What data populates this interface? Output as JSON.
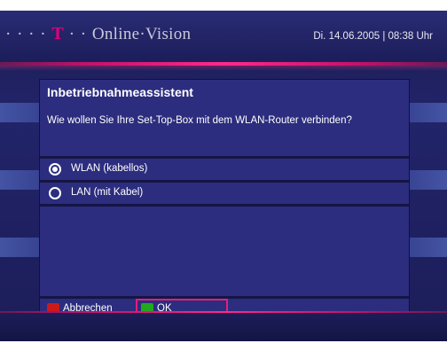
{
  "header": {
    "brand_dots": "· · · · ",
    "brand_t": "T",
    "brand_dots2": " · · ",
    "brand_name": "Online·Vision",
    "datetime": "Di. 14.06.2005 | 08:38 Uhr"
  },
  "dialog": {
    "title": "Inbetriebnahmeassistent",
    "question": "Wie wollen Sie Ihre Set-Top-Box mit dem WLAN-Router verbinden?",
    "options": [
      {
        "label": "WLAN (kabellos)",
        "selected": true
      },
      {
        "label": "LAN (mit Kabel)",
        "selected": false
      }
    ],
    "buttons": {
      "cancel_label": "Abbrechen",
      "cancel_color": "#cc1a1a",
      "ok_label": "OK",
      "ok_color": "#22a81e"
    }
  },
  "colors": {
    "accent_pink": "#e0007a",
    "panel_bg": "#2c2d7e"
  }
}
